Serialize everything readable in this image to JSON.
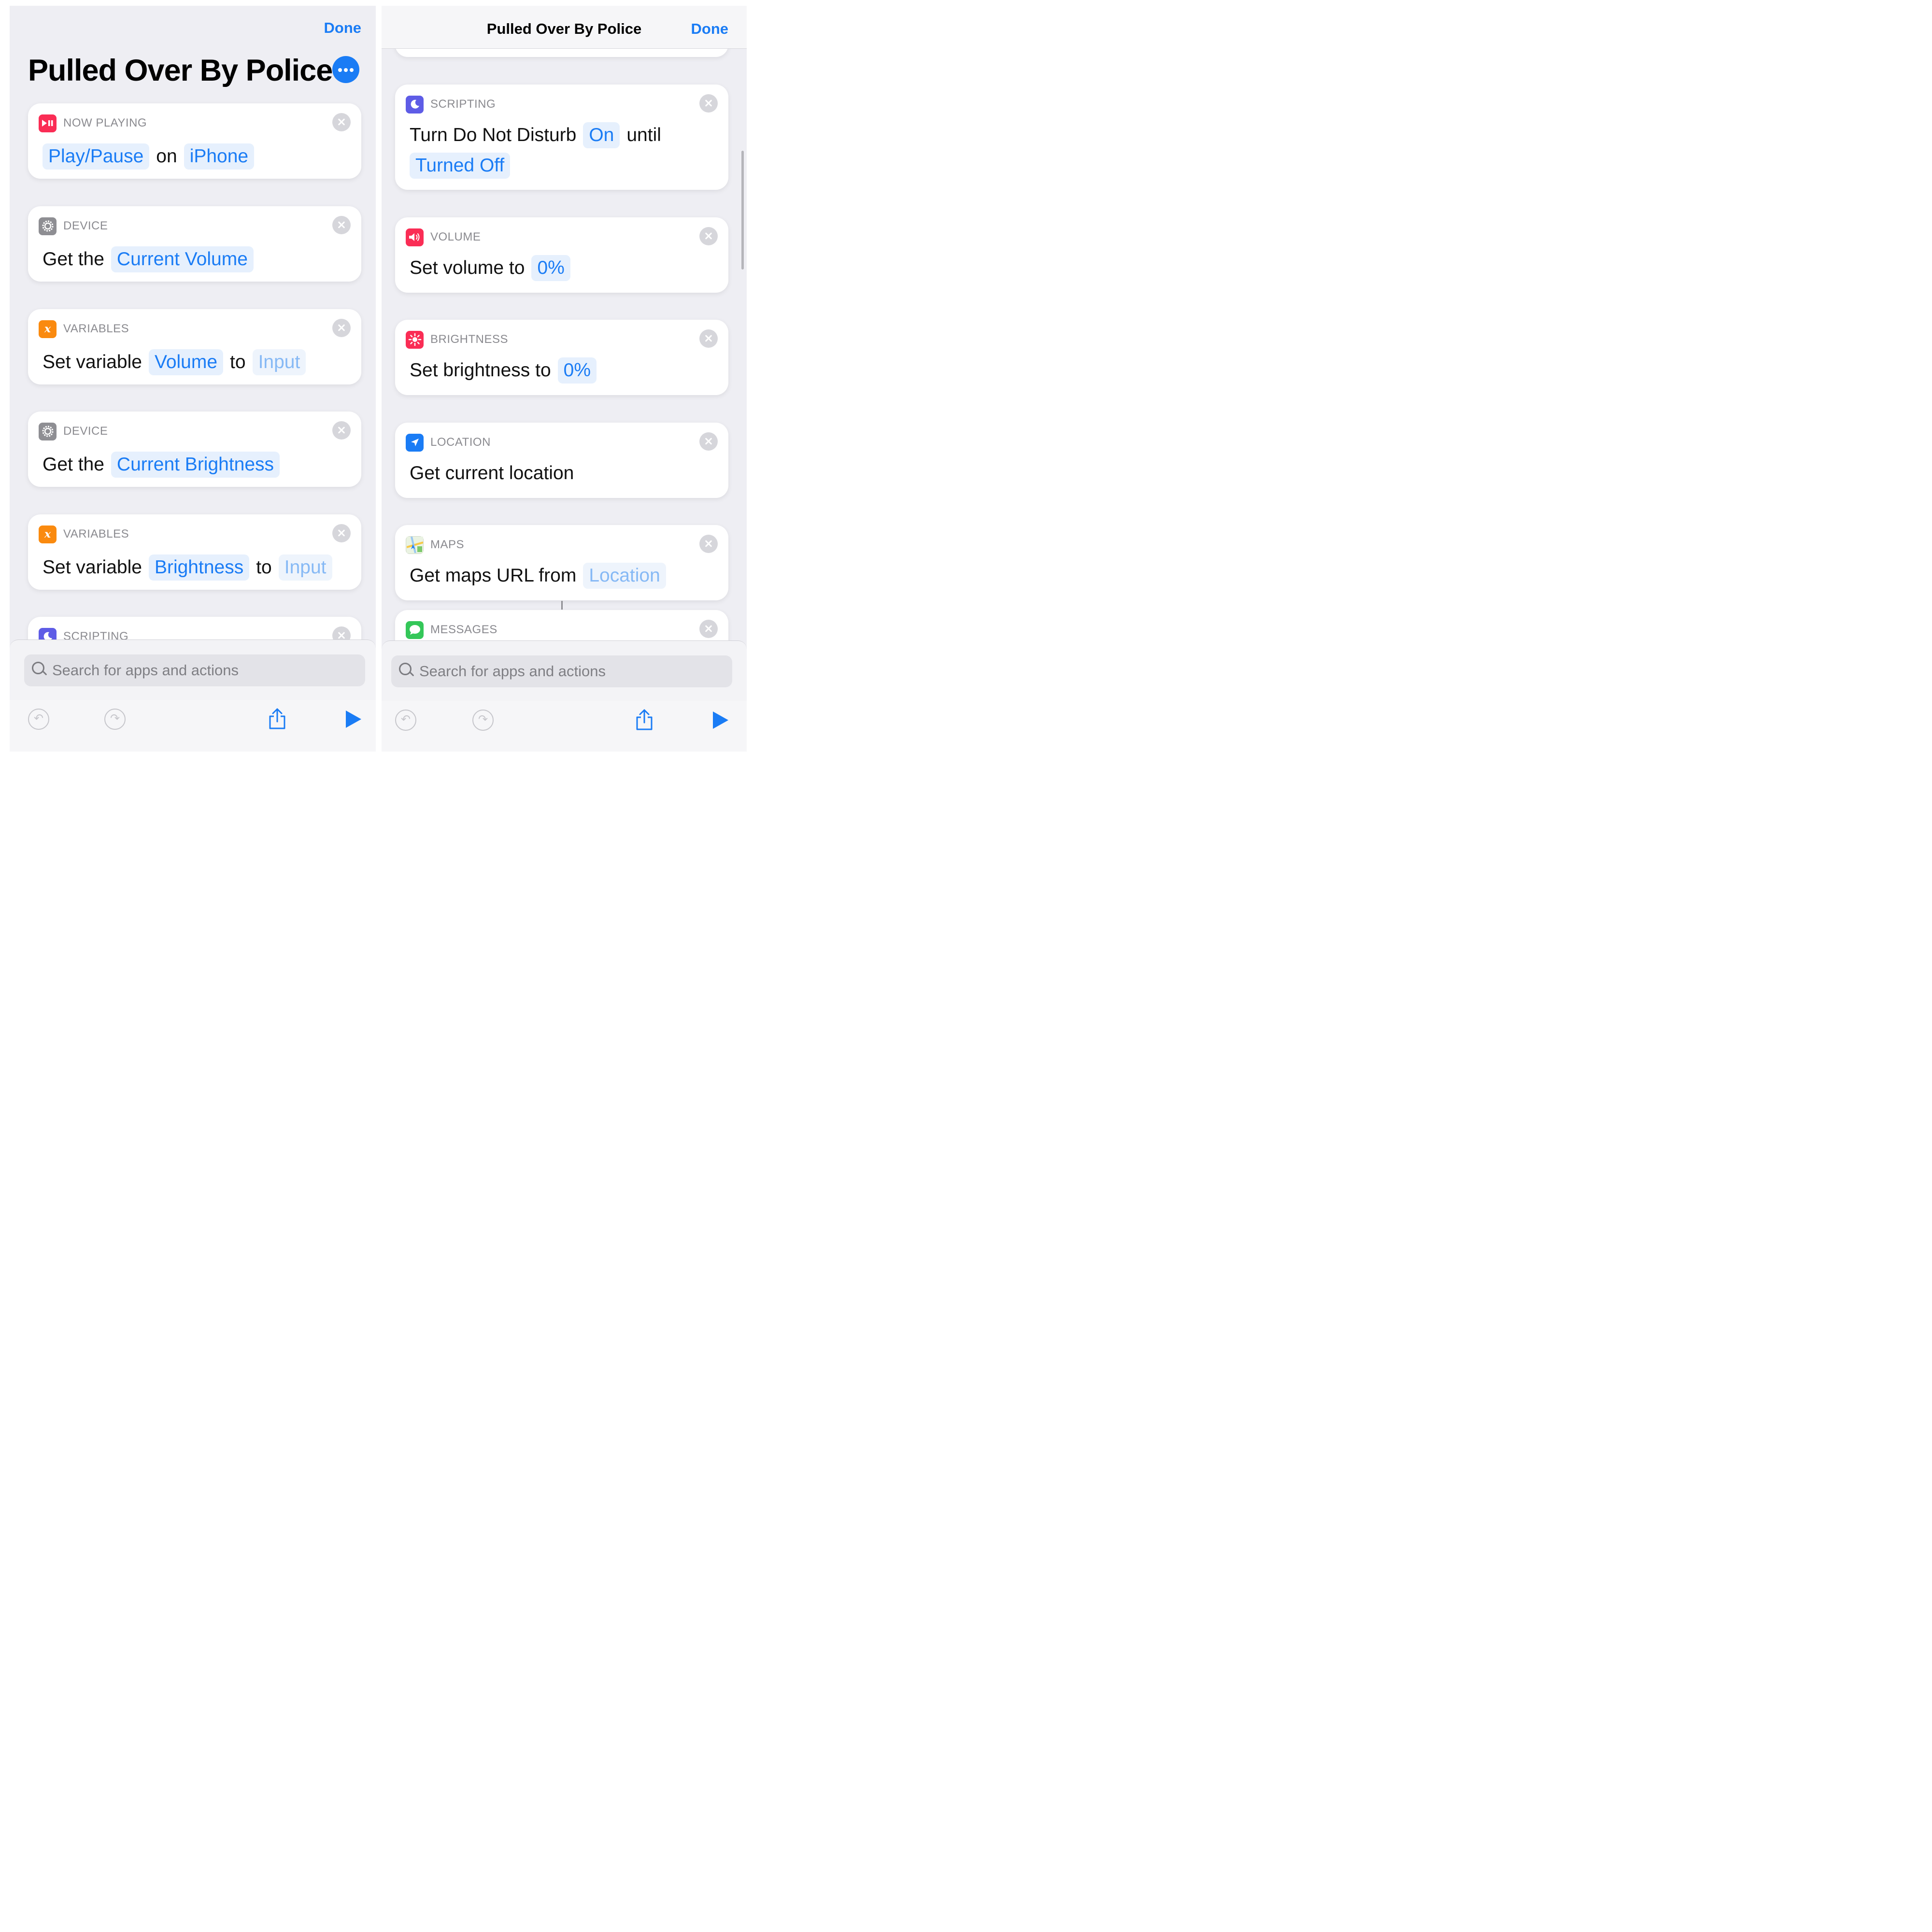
{
  "colors": {
    "accent": "#1a7cf5",
    "now_playing": "#fa2d55",
    "device": "#8e8e93",
    "variables": "#fa8a0f",
    "scripting": "#5e5ce6",
    "volume": "#fa2d55",
    "brightness": "#fa2d55",
    "location": "#1a7cf5",
    "messages": "#34c759"
  },
  "left": {
    "done_label": "Done",
    "title": "Pulled Over By Police",
    "cards": [
      {
        "category": "NOW PLAYING",
        "icon": "play-pause-icon",
        "parts": [
          "Play/Pause",
          "on",
          "iPhone"
        ]
      },
      {
        "category": "DEVICE",
        "icon": "gear-icon",
        "parts": [
          "Get the",
          "Current Volume"
        ]
      },
      {
        "category": "VARIABLES",
        "icon": "variable-x-icon",
        "parts": [
          "Set variable",
          "Volume",
          "to",
          "Input"
        ]
      },
      {
        "category": "DEVICE",
        "icon": "gear-icon",
        "parts": [
          "Get the",
          "Current Brightness"
        ]
      },
      {
        "category": "VARIABLES",
        "icon": "variable-x-icon",
        "parts": [
          "Set variable",
          "Brightness",
          "to",
          "Input"
        ]
      },
      {
        "category": "SCRIPTING",
        "icon": "moon-icon"
      }
    ],
    "search_placeholder": "Search for apps and actions"
  },
  "right": {
    "nav_title": "Pulled Over By Police",
    "done_label": "Done",
    "cards": [
      {
        "category": "SCRIPTING",
        "icon": "moon-icon",
        "parts": [
          "Turn Do Not Disturb",
          "On",
          "until",
          "Turned Off"
        ]
      },
      {
        "category": "VOLUME",
        "icon": "speaker-icon",
        "parts": [
          "Set volume to",
          "0%"
        ]
      },
      {
        "category": "BRIGHTNESS",
        "icon": "sun-icon",
        "parts": [
          "Set brightness to",
          "0%"
        ]
      },
      {
        "category": "LOCATION",
        "icon": "location-arrow-icon",
        "parts": [
          "Get current location"
        ]
      },
      {
        "category": "MAPS",
        "icon": "maps-icon",
        "parts": [
          "Get maps URL from",
          "Location"
        ]
      },
      {
        "category": "MESSAGES",
        "icon": "message-bubble-icon"
      }
    ],
    "search_placeholder": "Search for apps and actions"
  }
}
